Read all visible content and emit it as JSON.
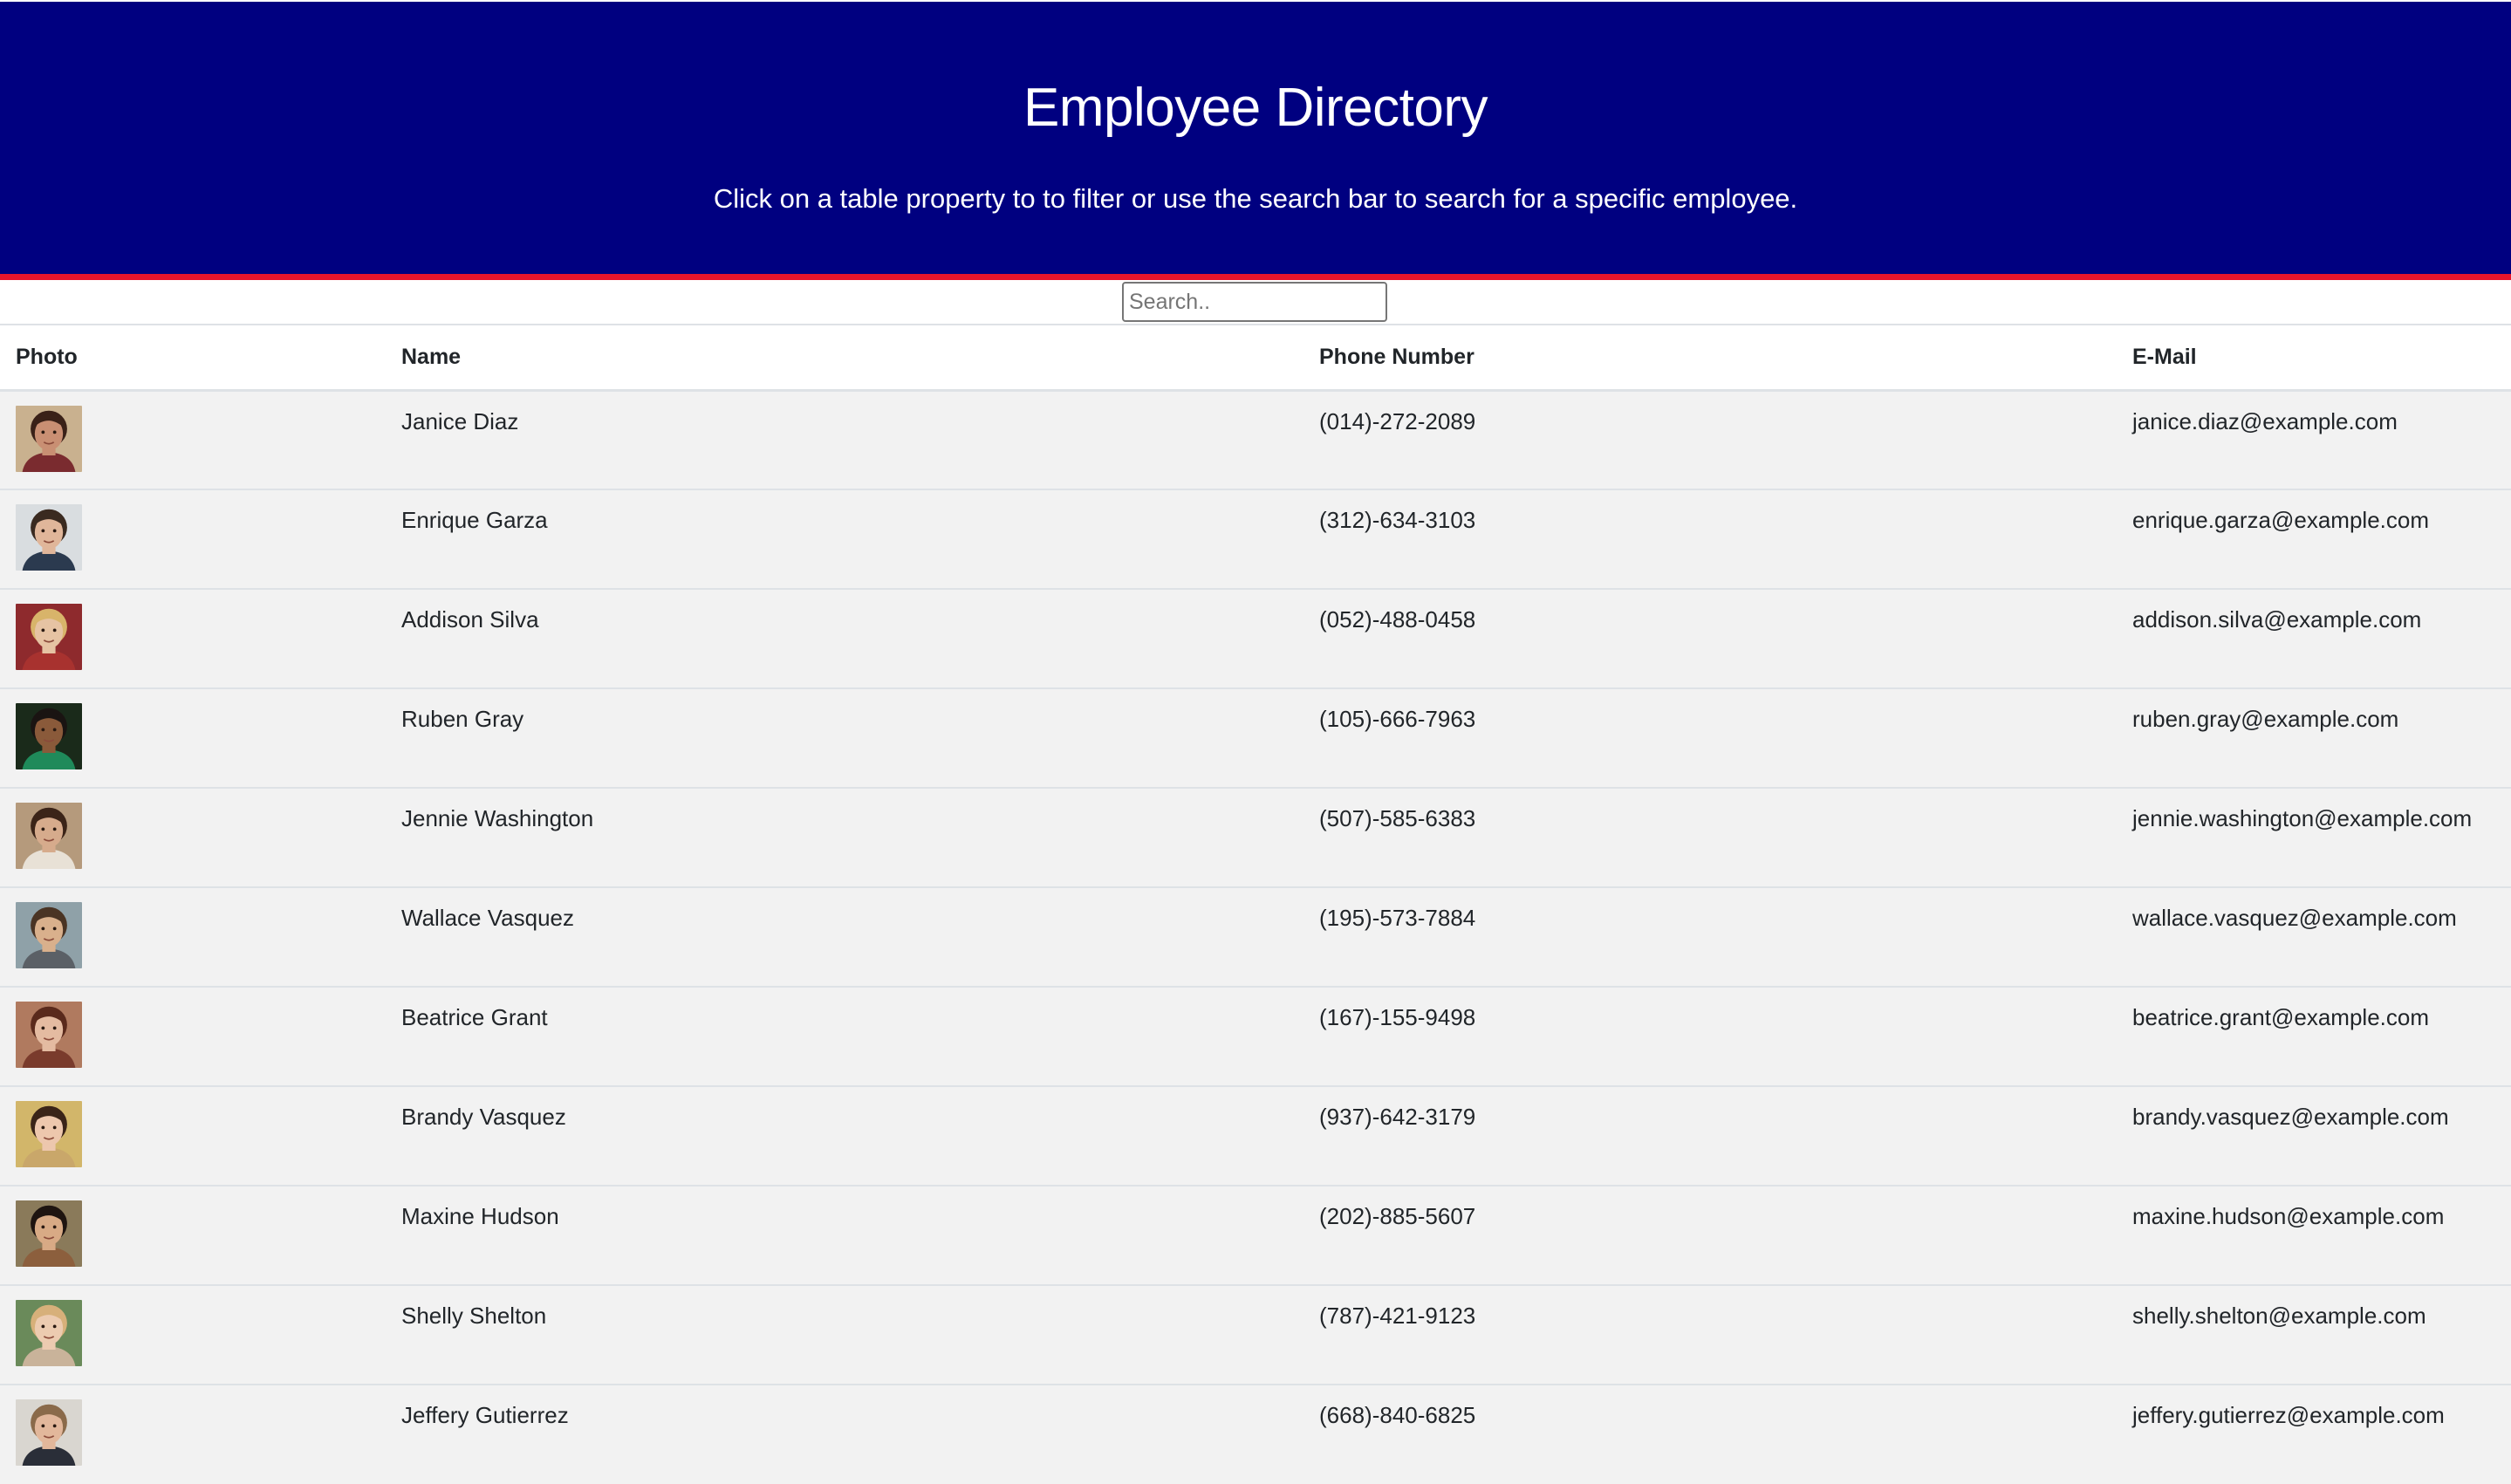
{
  "header": {
    "title": "Employee Directory",
    "subtitle": "Click on a table property to to filter or use the search bar to search for a specific employee."
  },
  "search": {
    "placeholder": "Search..",
    "value": ""
  },
  "table": {
    "columns": [
      "Photo",
      "Name",
      "Phone Number",
      "E-Mail"
    ],
    "rows": [
      {
        "name": "Janice Diaz",
        "phone": "(014)-272-2089",
        "email": "janice.diaz@example.com",
        "photo": {
          "bg": "#c9b18f",
          "skin": "#c98f73",
          "hair": "#3a2118",
          "shirt": "#7a2b2f"
        }
      },
      {
        "name": "Enrique Garza",
        "phone": "(312)-634-3103",
        "email": "enrique.garza@example.com",
        "photo": {
          "bg": "#d9dde0",
          "skin": "#e0b69a",
          "hair": "#3a2a20",
          "shirt": "#2b3a4f"
        }
      },
      {
        "name": "Addison Silva",
        "phone": "(052)-488-0458",
        "email": "addison.silva@example.com",
        "photo": {
          "bg": "#8e2a2d",
          "skin": "#e6c3a3",
          "hair": "#d8b46a",
          "shirt": "#a8322f"
        }
      },
      {
        "name": "Ruben Gray",
        "phone": "(105)-666-7963",
        "email": "ruben.gray@example.com",
        "photo": {
          "bg": "#1a2a1a",
          "skin": "#8a5a3a",
          "hair": "#1a1412",
          "shirt": "#1f8a5a"
        }
      },
      {
        "name": "Jennie Washington",
        "phone": "(507)-585-6383",
        "email": "jennie.washington@example.com",
        "photo": {
          "bg": "#b59a7c",
          "skin": "#d6ab8c",
          "hair": "#3b2418",
          "shirt": "#e8e1d6"
        }
      },
      {
        "name": "Wallace Vasquez",
        "phone": "(195)-573-7884",
        "email": "wallace.vasquez@example.com",
        "photo": {
          "bg": "#8fa1a8",
          "skin": "#d9b08c",
          "hair": "#4a3424",
          "shirt": "#5b6066"
        }
      },
      {
        "name": "Beatrice Grant",
        "phone": "(167)-155-9498",
        "email": "beatrice.grant@example.com",
        "photo": {
          "bg": "#b07a5f",
          "skin": "#e4bba1",
          "hair": "#5a2a1c",
          "shirt": "#7a3b2c"
        }
      },
      {
        "name": "Brandy Vasquez",
        "phone": "(937)-642-3179",
        "email": "brandy.vasquez@example.com",
        "photo": {
          "bg": "#d2b66a",
          "skin": "#edc7ad",
          "hair": "#3a2418",
          "shirt": "#c9a76a"
        }
      },
      {
        "name": "Maxine Hudson",
        "phone": "(202)-885-5607",
        "email": "maxine.hudson@example.com",
        "photo": {
          "bg": "#8a7a5a",
          "skin": "#d8aa85",
          "hair": "#1e1410",
          "shirt": "#8c5f3d"
        }
      },
      {
        "name": "Shelly Shelton",
        "phone": "(787)-421-9123",
        "email": "shelly.shelton@example.com",
        "photo": {
          "bg": "#6a8a5a",
          "skin": "#eccbb0",
          "hair": "#d7b07a",
          "shirt": "#c9b39a"
        }
      },
      {
        "name": "Jeffery Gutierrez",
        "phone": "(668)-840-6825",
        "email": "jeffery.gutierrez@example.com",
        "photo": {
          "bg": "#d9d6d0",
          "skin": "#e2b79b",
          "hair": "#8a6a4a",
          "shirt": "#2a2e38"
        }
      }
    ]
  },
  "colors": {
    "header_bg": "#000080",
    "header_border": "#e8152b",
    "row_bg": "#f2f2f2"
  }
}
